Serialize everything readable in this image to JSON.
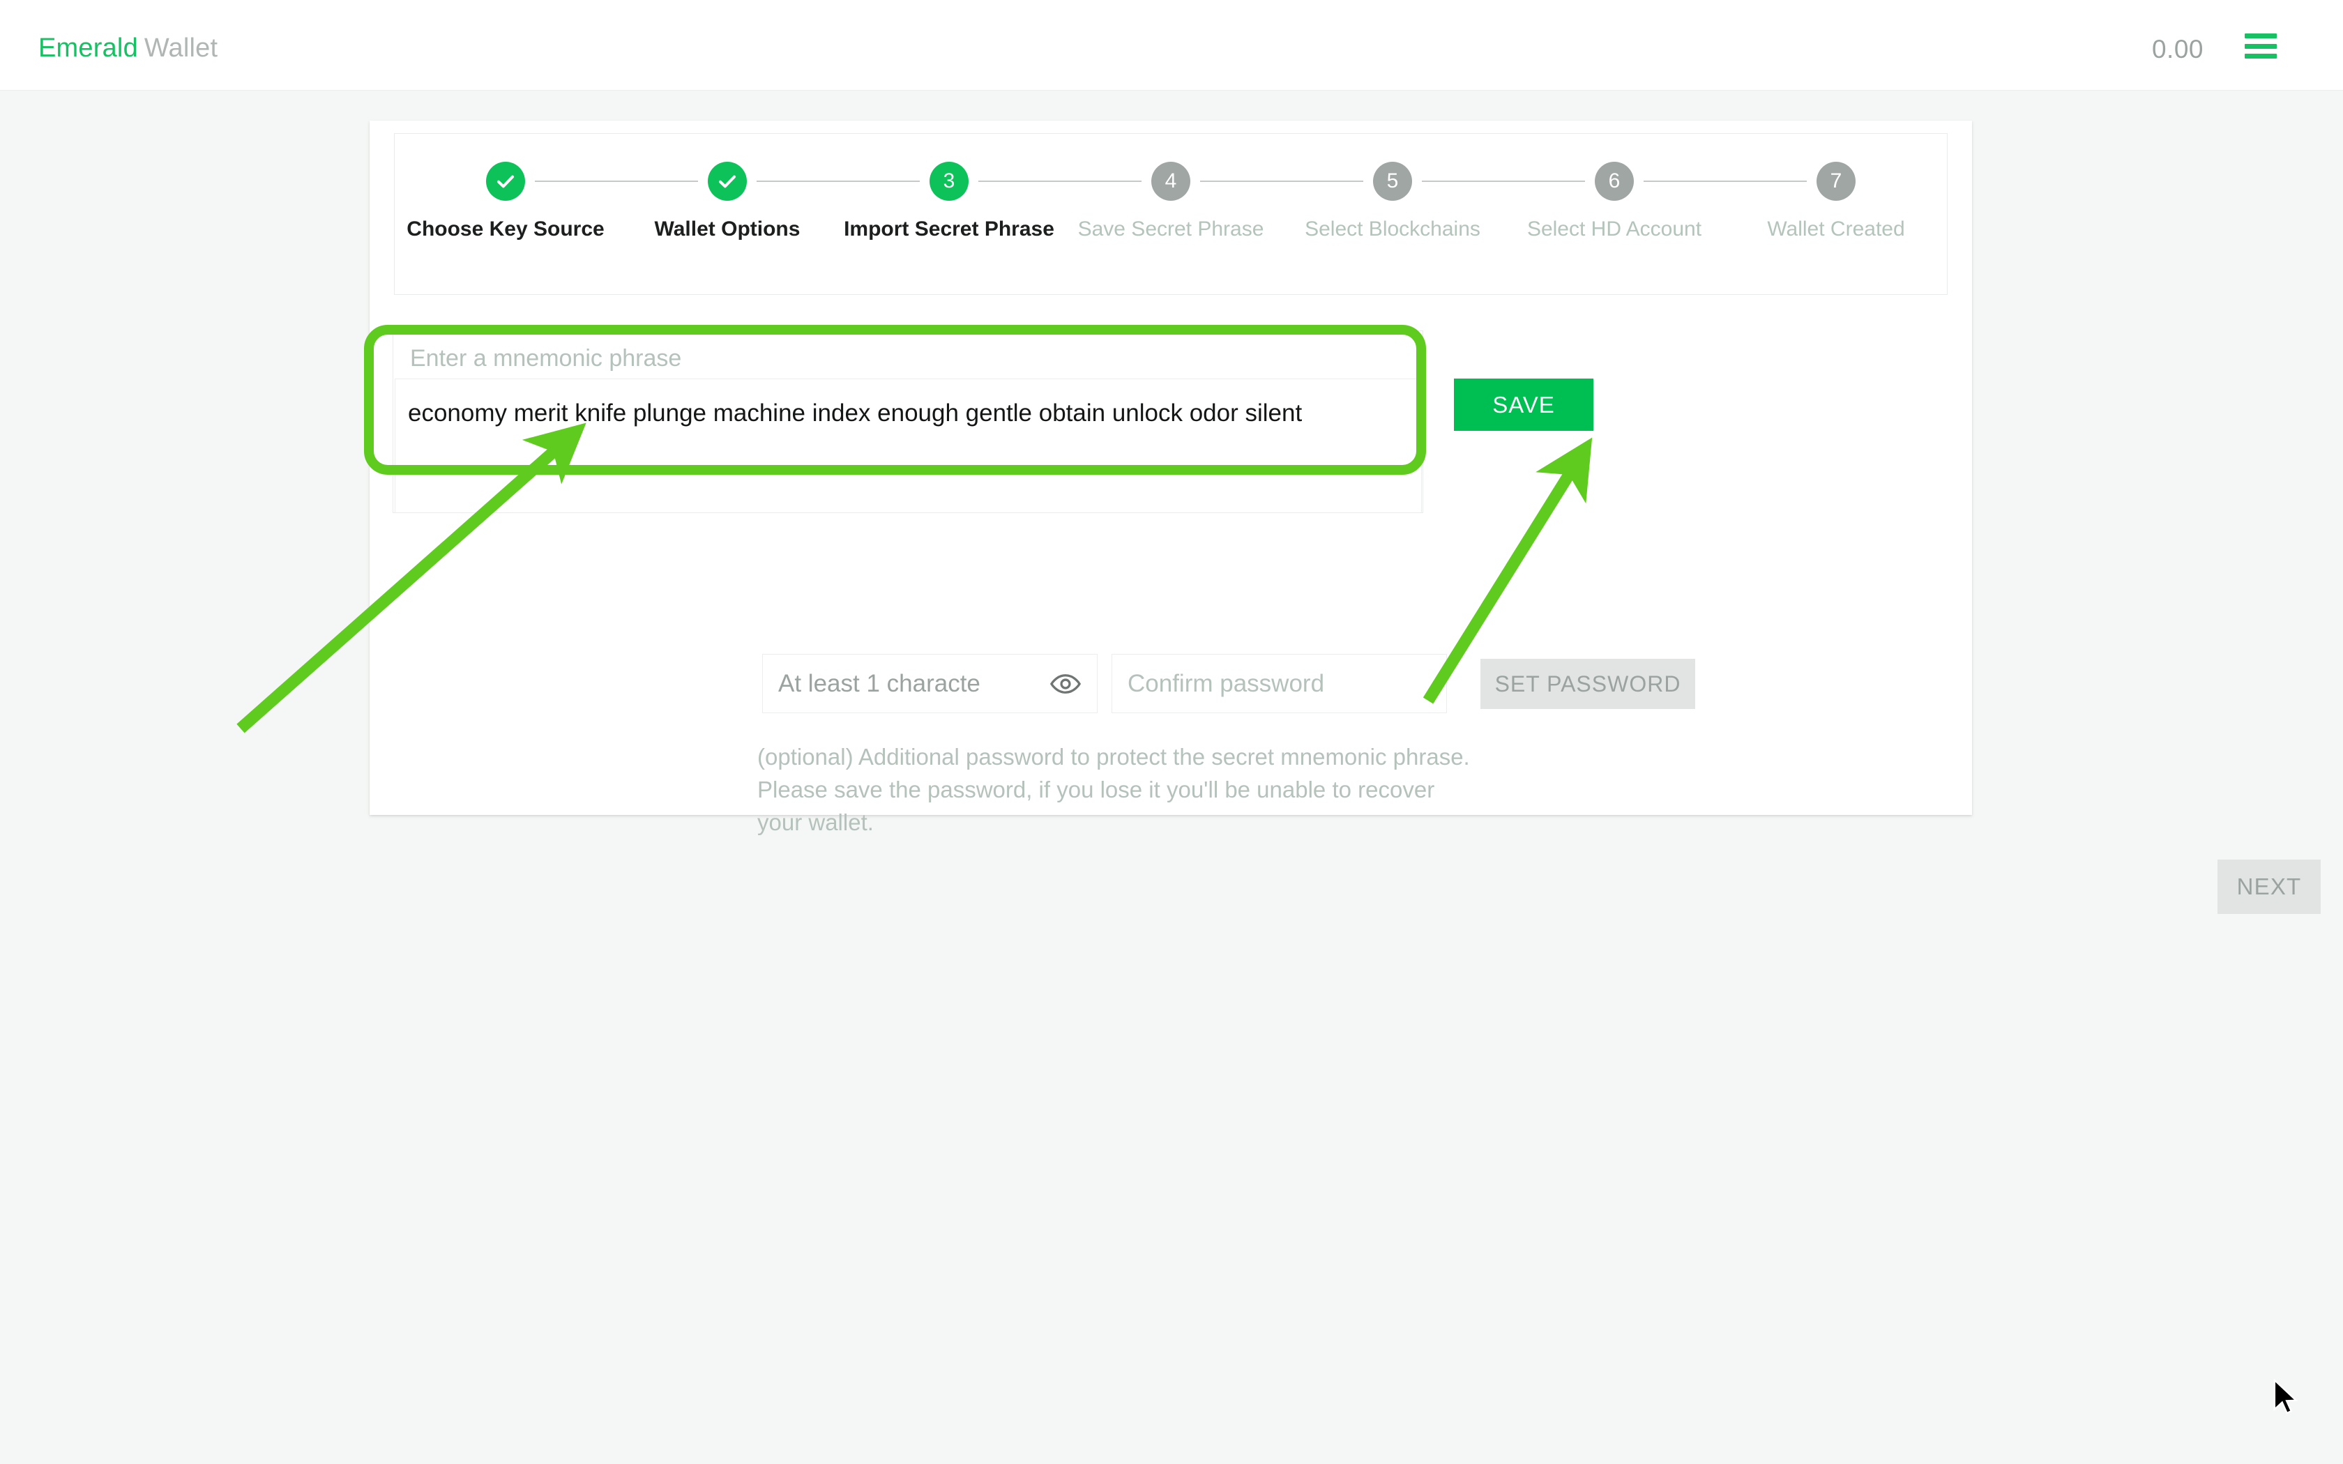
{
  "header": {
    "brand_primary": "Emerald",
    "brand_secondary": "Wallet",
    "balance": "0.00",
    "menu_icon": "hamburger-menu-icon"
  },
  "stepper": {
    "steps": [
      {
        "number": "1",
        "label": "Choose Key Source",
        "state": "done"
      },
      {
        "number": "2",
        "label": "Wallet Options",
        "state": "done"
      },
      {
        "number": "3",
        "label": "Import Secret Phrase",
        "state": "active"
      },
      {
        "number": "4",
        "label": "Save Secret Phrase",
        "state": "pending"
      },
      {
        "number": "5",
        "label": "Select Blockchains",
        "state": "pending"
      },
      {
        "number": "6",
        "label": "Select HD Account",
        "state": "pending"
      },
      {
        "number": "7",
        "label": "Wallet Created",
        "state": "pending"
      }
    ]
  },
  "mnemonic": {
    "legend": "Enter a mnemonic phrase",
    "value": "economy merit knife plunge machine index enough gentle obtain unlock odor silent",
    "placeholder": ""
  },
  "save_button": {
    "label": "SAVE"
  },
  "password": {
    "password_placeholder": "At least 1 characte",
    "confirm_placeholder": "Confirm password",
    "reveal_icon": "eye-icon",
    "set_password_label": "SET PASSWORD",
    "helper_text": "(optional) Additional password to protect the secret mnemonic phrase. Please save the password, if you lose it you'll be unable to recover your wallet."
  },
  "next_button": {
    "label": "NEXT"
  },
  "colors": {
    "brand_green": "#16c163",
    "step_done_green": "#0ec25a",
    "save_green": "#00bf52",
    "annotation_green": "#5ecb1e",
    "step_pending_gray": "#a0a6a3",
    "disabled_gray": "#e2e4e3",
    "muted_text": "#b4c2bb",
    "page_bg": "#f5f7f6"
  },
  "annotations": {
    "highlight_target": "mnemonic-input-field",
    "arrow_1_target": "mnemonic-input-field",
    "arrow_2_target": "save-button"
  },
  "cursor": {
    "position": "3265,1985"
  }
}
